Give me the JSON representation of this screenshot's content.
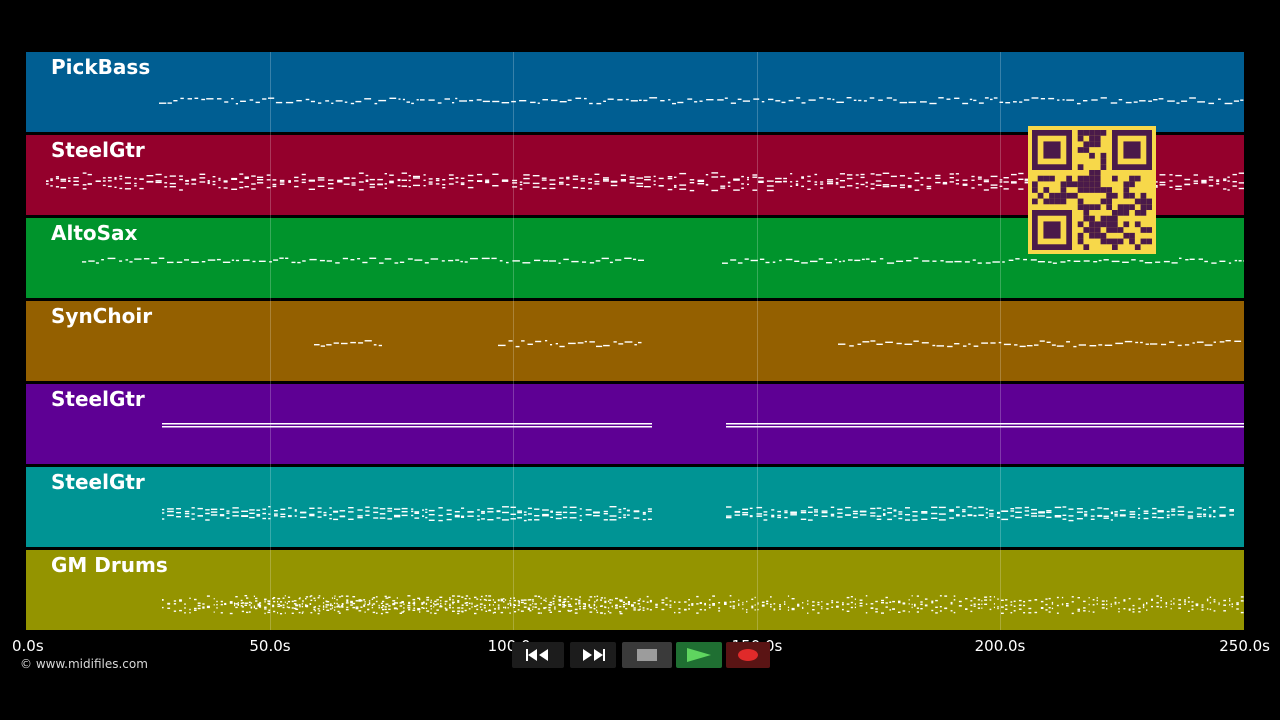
{
  "tracks": [
    {
      "name": "PickBass",
      "color": "#005e92"
    },
    {
      "name": "SteelGtr",
      "color": "#94002c"
    },
    {
      "name": "AltoSax",
      "color": "#00942c"
    },
    {
      "name": "SynChoir",
      "color": "#946000"
    },
    {
      "name": "SteelGtr",
      "color": "#5e0094"
    },
    {
      "name": "SteelGtr",
      "color": "#009494"
    },
    {
      "name": "GM Drums",
      "color": "#949400"
    }
  ],
  "timeline": {
    "ticks": [
      "0.0s",
      "50.0s",
      "100.0s",
      "150.0s",
      "200.0s",
      "250.0s"
    ]
  },
  "footer": {
    "copyright": "© www.midifiles.com"
  },
  "transport": {
    "buttons": [
      {
        "icon": "rewind-icon",
        "label": "rewind"
      },
      {
        "icon": "fast-forward-icon",
        "label": "fast-forward"
      },
      {
        "icon": "stop-icon",
        "label": "stop"
      },
      {
        "icon": "play-icon",
        "label": "play"
      },
      {
        "icon": "record-icon",
        "label": "record"
      }
    ]
  },
  "qr_code": {
    "color": "#f7d84a",
    "icon": "qr-code-icon"
  }
}
